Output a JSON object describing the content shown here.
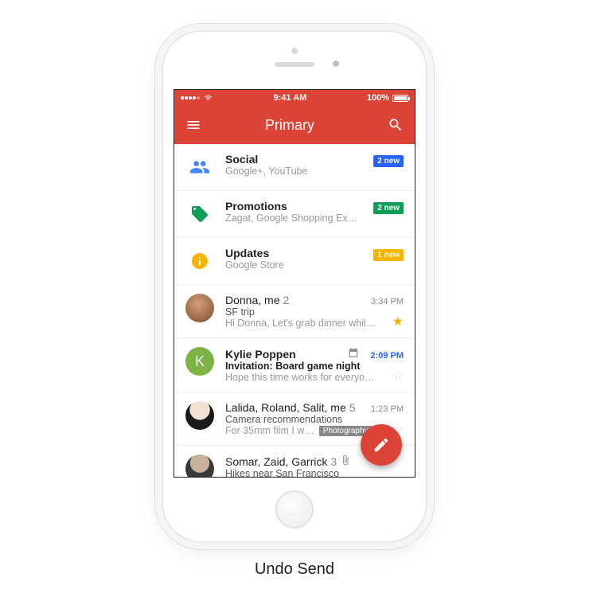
{
  "caption": "Undo Send",
  "statusbar": {
    "time": "9:41 AM",
    "battery": "100%"
  },
  "appbar": {
    "title": "Primary"
  },
  "categories": [
    {
      "icon": "people",
      "title": "Social",
      "sub": "Google+, YouTube",
      "badge": "2 new",
      "badge_color": "blue"
    },
    {
      "icon": "tag",
      "title": "Promotions",
      "sub": "Zagat, Google Shopping Ex…",
      "badge": "2 new",
      "badge_color": "green"
    },
    {
      "icon": "info",
      "title": "Updates",
      "sub": "Google Store",
      "badge": "1 new",
      "badge_color": "yellow"
    }
  ],
  "emails": [
    {
      "avatar_type": "photo",
      "avatar_bg": "#a05a3c",
      "from": "Donna, me",
      "count": "2",
      "time": "3:34 PM",
      "subject": "SF trip",
      "snippet": "Hi Donna, Let's grab dinner whil…",
      "starred": true,
      "unread": false
    },
    {
      "avatar_type": "letter",
      "avatar_letter": "K",
      "avatar_bg": "#7cb342",
      "from": "Kylie Poppen",
      "time": "2:09 PM",
      "time_blue": true,
      "calendar": true,
      "subject": "Invitation: Board game night",
      "snippet": "Hope this time works for everyo…",
      "starred": false,
      "unread": true
    },
    {
      "avatar_type": "photo",
      "avatar_bg": "#222",
      "from": "Lalida, Roland, Salit, me",
      "count": "5",
      "time": "1:23 PM",
      "subject": "Camera recommendations",
      "snippet": "For 35mm film I w…",
      "tag": "Photography",
      "starred": false,
      "unread": false
    },
    {
      "avatar_type": "photo",
      "avatar_bg": "#555",
      "from": "Somar, Zaid, Garrick",
      "count": "3",
      "attachment": true,
      "subject": "Hikes near San Francisco",
      "snippet": "",
      "starred": false,
      "unread": false
    }
  ]
}
